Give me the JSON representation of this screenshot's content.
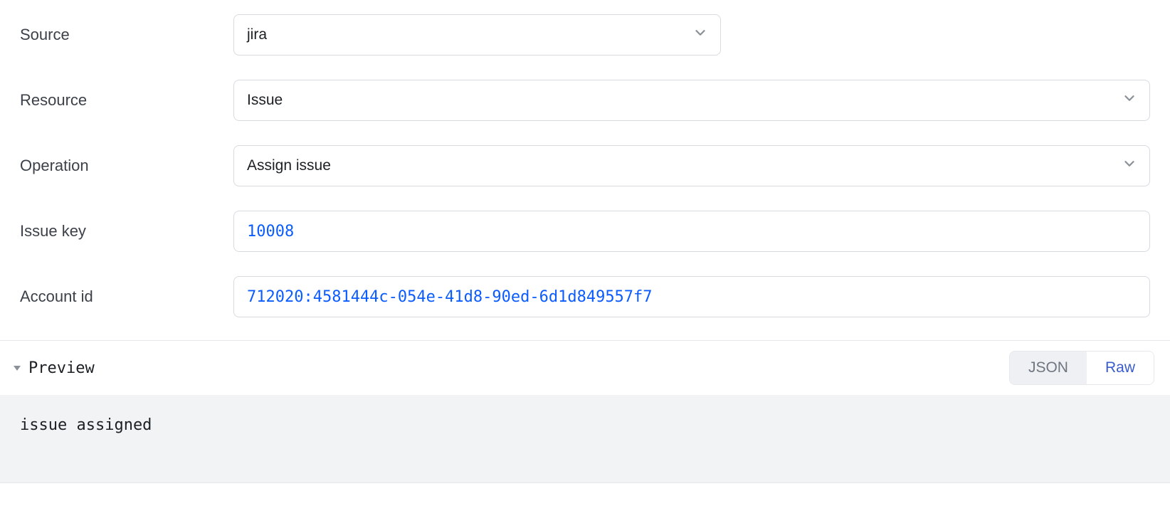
{
  "form": {
    "source": {
      "label": "Source",
      "value": "jira"
    },
    "resource": {
      "label": "Resource",
      "value": "Issue"
    },
    "operation": {
      "label": "Operation",
      "value": "Assign issue"
    },
    "issue_key": {
      "label": "Issue key",
      "value": "10008"
    },
    "account_id": {
      "label": "Account id",
      "value": "712020:4581444c-054e-41d8-90ed-6d1d849557f7"
    }
  },
  "preview": {
    "title": "Preview",
    "toggle": {
      "json": "JSON",
      "raw": "Raw"
    },
    "body": "issue assigned"
  }
}
